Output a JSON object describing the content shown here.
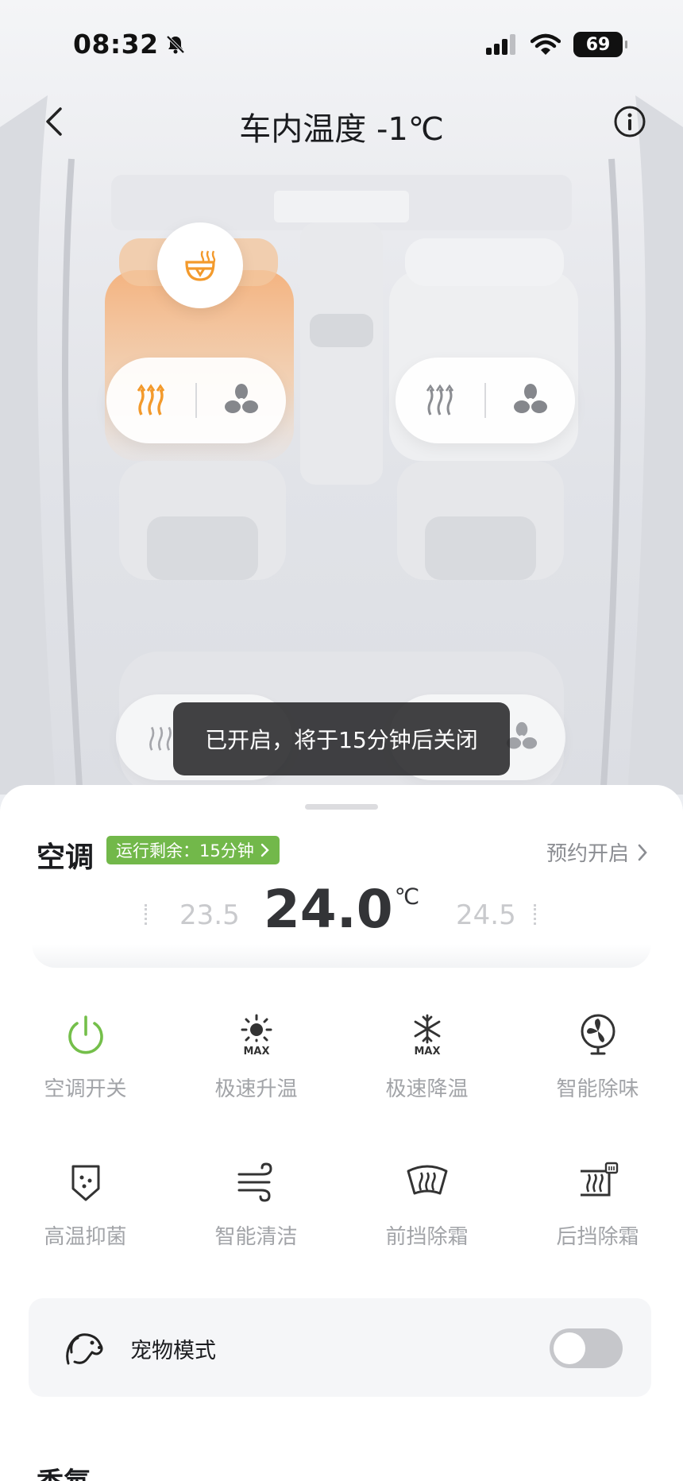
{
  "status_bar": {
    "time": "08:32",
    "battery": "69"
  },
  "nav": {
    "title": "车内温度 -1℃"
  },
  "toast": "已开启，将于15分钟后关闭",
  "ac": {
    "title": "空调",
    "run_badge": "运行剩余：15分钟",
    "schedule_label": "预约开启",
    "temp_prev": "23.5",
    "temp_current": "24.0",
    "temp_unit": "℃",
    "temp_next": "24.5"
  },
  "functions": [
    {
      "label": "空调开关",
      "icon": "power-icon"
    },
    {
      "label": "极速升温",
      "icon": "sun-max-icon"
    },
    {
      "label": "极速降温",
      "icon": "snowflake-max-icon"
    },
    {
      "label": "智能除味",
      "icon": "fan-circle-icon"
    },
    {
      "label": "高温抑菌",
      "icon": "shield-dots-icon"
    },
    {
      "label": "智能清洁",
      "icon": "wind-icon"
    },
    {
      "label": "前挡除霜",
      "icon": "front-defrost-icon"
    },
    {
      "label": "后挡除霜",
      "icon": "rear-defrost-icon"
    }
  ],
  "pet_mode": {
    "label": "宠物模式",
    "enabled": false
  },
  "next_section": {
    "title": "香氛"
  },
  "colors": {
    "accent_orange": "#f39a2c",
    "power_green": "#74bf4a",
    "badge_green": "#72b84a"
  }
}
